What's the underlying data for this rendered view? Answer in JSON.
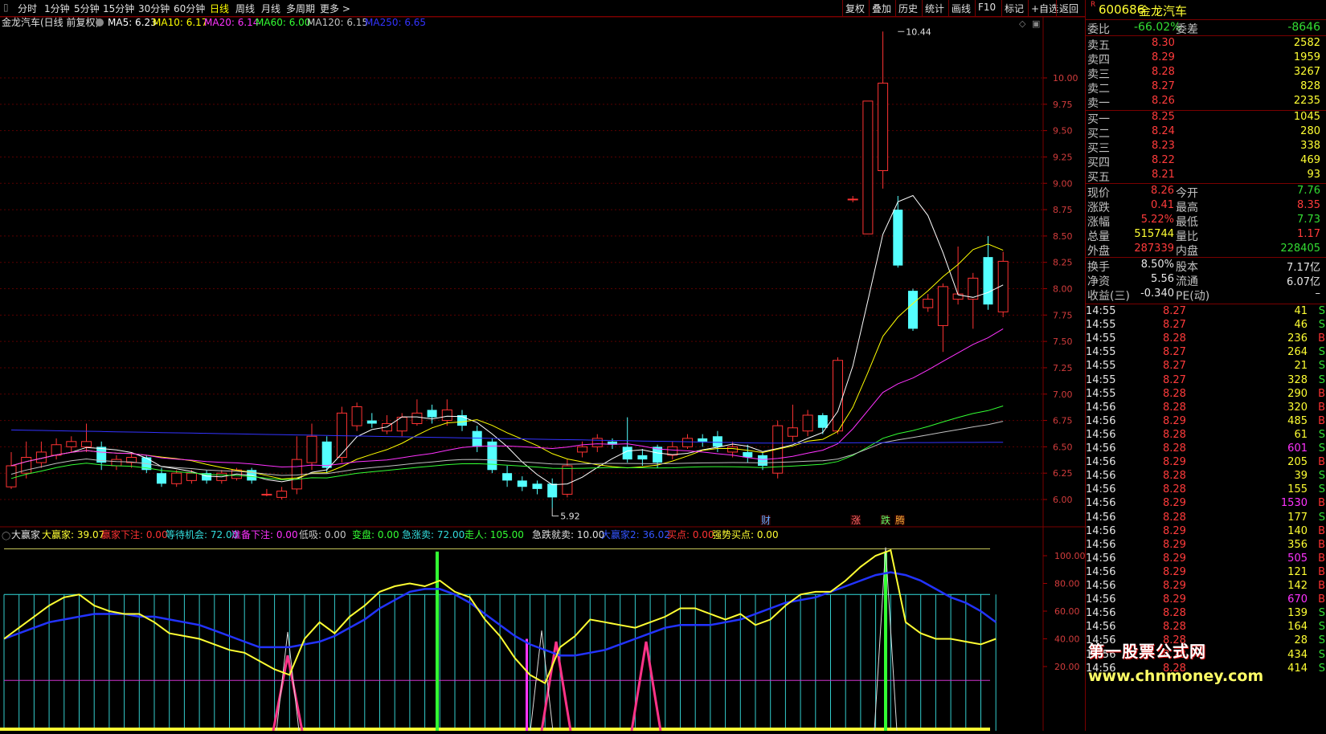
{
  "toolbar": {
    "periods": [
      "分时",
      "1分钟",
      "5分钟",
      "15分钟",
      "30分钟",
      "60分钟",
      "日线",
      "周线",
      "月线",
      "多周期",
      "更多 >"
    ],
    "active_period": "日线",
    "right_buttons": [
      "复权",
      "叠加",
      "历史",
      "统计",
      "画线",
      "F10",
      "标记",
      "+自选",
      "返回"
    ]
  },
  "main_chart": {
    "title": "金龙汽车(日线 前复权)",
    "ma_labels": [
      {
        "text": "MA5: 6.23",
        "color": "#ffffff"
      },
      {
        "text": "MA10: 6.17",
        "color": "#ffff00"
      },
      {
        "text": "MA20: 6.14",
        "color": "#ff33ff"
      },
      {
        "text": "MA60: 6.00",
        "color": "#33ff33"
      },
      {
        "text": "MA120: 6.15",
        "color": "#c0c0c0"
      },
      {
        "text": "MA250: 6.65",
        "color": "#3333ff"
      }
    ],
    "price_ticks": [
      "10.00",
      "9.75",
      "9.50",
      "9.25",
      "9.00",
      "8.75",
      "8.50",
      "8.25",
      "8.00",
      "7.75",
      "7.50",
      "7.25",
      "7.00",
      "6.75",
      "6.50",
      "6.25",
      "6.00"
    ],
    "high_label": "10.44",
    "low_label": "5.92",
    "markers": [
      {
        "text": "财",
        "color": "#66aaff"
      },
      {
        "text": "涨",
        "color": "#ff6666"
      },
      {
        "text": "跌",
        "color": "#66ff66"
      },
      {
        "text": "腾",
        "color": "#ffaa33"
      }
    ]
  },
  "chart_data": {
    "type": "candlestick",
    "ylim": [
      5.9,
      10.6
    ],
    "candles": [
      {
        "o": 6.12,
        "c": 6.32,
        "h": 6.45,
        "l": 6.1
      },
      {
        "o": 6.25,
        "c": 6.4,
        "h": 6.55,
        "l": 6.2
      },
      {
        "o": 6.35,
        "c": 6.45,
        "h": 6.55,
        "l": 6.3
      },
      {
        "o": 6.42,
        "c": 6.52,
        "h": 6.58,
        "l": 6.38
      },
      {
        "o": 6.5,
        "c": 6.55,
        "h": 6.6,
        "l": 6.45
      },
      {
        "o": 6.5,
        "c": 6.55,
        "h": 6.72,
        "l": 6.45
      },
      {
        "o": 6.5,
        "c": 6.35,
        "h": 6.55,
        "l": 6.28
      },
      {
        "o": 6.32,
        "c": 6.38,
        "h": 6.42,
        "l": 6.28
      },
      {
        "o": 6.35,
        "c": 6.4,
        "h": 6.45,
        "l": 6.3
      },
      {
        "o": 6.4,
        "c": 6.28,
        "h": 6.42,
        "l": 6.25
      },
      {
        "o": 6.25,
        "c": 6.15,
        "h": 6.3,
        "l": 6.12
      },
      {
        "o": 6.15,
        "c": 6.25,
        "h": 6.28,
        "l": 6.12
      },
      {
        "o": 6.18,
        "c": 6.25,
        "h": 6.28,
        "l": 6.15
      },
      {
        "o": 6.25,
        "c": 6.18,
        "h": 6.28,
        "l": 6.15
      },
      {
        "o": 6.18,
        "c": 6.25,
        "h": 6.28,
        "l": 6.15
      },
      {
        "o": 6.2,
        "c": 6.28,
        "h": 6.3,
        "l": 6.18
      },
      {
        "o": 6.28,
        "c": 6.18,
        "h": 6.3,
        "l": 6.15
      },
      {
        "o": 6.05,
        "c": 6.05,
        "h": 6.1,
        "l": 6.03
      },
      {
        "o": 6.02,
        "c": 6.08,
        "h": 6.12,
        "l": 6.0
      },
      {
        "o": 6.1,
        "c": 6.38,
        "h": 6.6,
        "l": 6.05
      },
      {
        "o": 6.35,
        "c": 6.6,
        "h": 6.72,
        "l": 6.28
      },
      {
        "o": 6.55,
        "c": 6.3,
        "h": 6.6,
        "l": 6.25
      },
      {
        "o": 6.4,
        "c": 6.82,
        "h": 6.88,
        "l": 6.35
      },
      {
        "o": 6.7,
        "c": 6.88,
        "h": 6.92,
        "l": 6.65
      },
      {
        "o": 6.75,
        "c": 6.72,
        "h": 6.82,
        "l": 6.68
      },
      {
        "o": 6.65,
        "c": 6.72,
        "h": 6.8,
        "l": 6.62
      },
      {
        "o": 6.65,
        "c": 6.78,
        "h": 6.82,
        "l": 6.6
      },
      {
        "o": 6.72,
        "c": 6.82,
        "h": 6.95,
        "l": 6.7
      },
      {
        "o": 6.85,
        "c": 6.78,
        "h": 6.9,
        "l": 6.72
      },
      {
        "o": 6.75,
        "c": 6.85,
        "h": 6.95,
        "l": 6.7
      },
      {
        "o": 6.8,
        "c": 6.7,
        "h": 6.85,
        "l": 6.65
      },
      {
        "o": 6.65,
        "c": 6.5,
        "h": 6.7,
        "l": 6.45
      },
      {
        "o": 6.55,
        "c": 6.28,
        "h": 6.58,
        "l": 6.25
      },
      {
        "o": 6.25,
        "c": 6.18,
        "h": 6.32,
        "l": 6.12
      },
      {
        "o": 6.18,
        "c": 6.12,
        "h": 6.22,
        "l": 6.08
      },
      {
        "o": 6.15,
        "c": 6.1,
        "h": 6.18,
        "l": 6.05
      },
      {
        "o": 6.15,
        "c": 6.02,
        "h": 6.2,
        "l": 5.92
      },
      {
        "o": 6.05,
        "c": 6.32,
        "h": 6.38,
        "l": 6.02
      },
      {
        "o": 6.45,
        "c": 6.5,
        "h": 6.55,
        "l": 6.4
      },
      {
        "o": 6.5,
        "c": 6.58,
        "h": 6.62,
        "l": 6.45
      },
      {
        "o": 6.55,
        "c": 6.52,
        "h": 6.58,
        "l": 6.48
      },
      {
        "o": 6.5,
        "c": 6.38,
        "h": 6.78,
        "l": 6.35
      },
      {
        "o": 6.42,
        "c": 6.38,
        "h": 6.48,
        "l": 6.32
      },
      {
        "o": 6.5,
        "c": 6.35,
        "h": 6.52,
        "l": 6.3
      },
      {
        "o": 6.42,
        "c": 6.5,
        "h": 6.55,
        "l": 6.38
      },
      {
        "o": 6.5,
        "c": 6.58,
        "h": 6.62,
        "l": 6.48
      },
      {
        "o": 6.58,
        "c": 6.55,
        "h": 6.62,
        "l": 6.5
      },
      {
        "o": 6.6,
        "c": 6.5,
        "h": 6.65,
        "l": 6.45
      },
      {
        "o": 6.45,
        "c": 6.5,
        "h": 6.55,
        "l": 6.4
      },
      {
        "o": 6.45,
        "c": 6.4,
        "h": 6.52,
        "l": 6.35
      },
      {
        "o": 6.42,
        "c": 6.32,
        "h": 6.45,
        "l": 6.28
      },
      {
        "o": 6.25,
        "c": 6.7,
        "h": 6.75,
        "l": 6.2
      },
      {
        "o": 6.6,
        "c": 6.68,
        "h": 6.9,
        "l": 6.55
      },
      {
        "o": 6.65,
        "c": 6.8,
        "h": 6.85,
        "l": 6.6
      },
      {
        "o": 6.8,
        "c": 6.68,
        "h": 6.82,
        "l": 6.62
      },
      {
        "o": 6.65,
        "c": 7.32,
        "h": 7.35,
        "l": 6.62
      },
      {
        "o": 8.85,
        "c": 8.85,
        "h": 8.88,
        "l": 8.82
      },
      {
        "o": 8.52,
        "c": 9.78,
        "h": 9.78,
        "l": 8.52
      },
      {
        "o": 9.12,
        "c": 9.95,
        "h": 10.44,
        "l": 8.95
      },
      {
        "o": 8.75,
        "c": 8.22,
        "h": 8.88,
        "l": 8.2
      },
      {
        "o": 7.98,
        "c": 7.62,
        "h": 8.0,
        "l": 7.6
      },
      {
        "o": 7.82,
        "c": 7.9,
        "h": 7.95,
        "l": 7.78
      },
      {
        "o": 7.65,
        "c": 8.02,
        "h": 8.05,
        "l": 7.4
      },
      {
        "o": 7.9,
        "c": 7.95,
        "h": 8.4,
        "l": 7.85
      },
      {
        "o": 7.9,
        "c": 8.1,
        "h": 8.15,
        "l": 7.62
      },
      {
        "o": 8.3,
        "c": 7.85,
        "h": 8.5,
        "l": 7.8
      },
      {
        "o": 7.78,
        "c": 8.26,
        "h": 8.35,
        "l": 7.73
      }
    ]
  },
  "indicator": {
    "name": "大赢家",
    "labels": [
      {
        "text": "大赢家: 39.07",
        "color": "#ffff33"
      },
      {
        "text": "赢家下注: 0.00",
        "color": "#ff3333"
      },
      {
        "text": "等待机会: 72.00",
        "color": "#33dddd"
      },
      {
        "text": "准备下注: 0.00",
        "color": "#ff33ff"
      },
      {
        "text": "低吸: 0.00",
        "color": "#c8c8c8"
      },
      {
        "text": "变盘: 0.00",
        "color": "#33ff33"
      },
      {
        "text": "急涨卖: 72.00",
        "color": "#33dddd"
      },
      {
        "text": "走人: 105.00",
        "color": "#33ff33"
      },
      {
        "text": "急跌就卖: 10.00",
        "color": "#e0e0e0"
      },
      {
        "text": "大赢家2: 36.02",
        "color": "#3355ff"
      },
      {
        "text": "买点: 0.00",
        "color": "#ff3333"
      },
      {
        "text": "强势买点: 0.00",
        "color": "#ffff33"
      }
    ],
    "ticks": [
      "100.00",
      "80.00",
      "60.00",
      "40.00",
      "20.00"
    ],
    "yellow_line": [
      40,
      48,
      56,
      64,
      70,
      72,
      64,
      60,
      58,
      58,
      52,
      44,
      42,
      40,
      36,
      32,
      30,
      24,
      18,
      14,
      40,
      52,
      44,
      56,
      64,
      74,
      78,
      80,
      78,
      82,
      74,
      70,
      54,
      42,
      26,
      14,
      8,
      34,
      42,
      54,
      52,
      50,
      48,
      52,
      56,
      62,
      62,
      58,
      54,
      58,
      50,
      54,
      64,
      72,
      74,
      74,
      82,
      92,
      100,
      104,
      52,
      44,
      40,
      40,
      38,
      36,
      40
    ],
    "blue_line": [
      40,
      44,
      48,
      52,
      54,
      56,
      58,
      58,
      58,
      56,
      56,
      54,
      52,
      50,
      46,
      42,
      38,
      34,
      34,
      34,
      36,
      38,
      42,
      48,
      54,
      62,
      68,
      74,
      76,
      76,
      72,
      66,
      58,
      50,
      42,
      36,
      32,
      28,
      28,
      30,
      32,
      36,
      40,
      44,
      48,
      50,
      50,
      50,
      52,
      54,
      58,
      62,
      66,
      68,
      70,
      74,
      78,
      82,
      86,
      88,
      86,
      82,
      76,
      70,
      66,
      60,
      52
    ]
  },
  "quote": {
    "code": "600686",
    "name": "金龙汽车",
    "r_tag": "R",
    "webi_label": "委比",
    "webi_value": "-66.02%",
    "weicha_label": "委差",
    "weicha_value": "-8646",
    "sell": [
      {
        "label": "卖五",
        "price": "8.30",
        "vol": "2582"
      },
      {
        "label": "卖四",
        "price": "8.29",
        "vol": "1959"
      },
      {
        "label": "卖三",
        "price": "8.28",
        "vol": "3267"
      },
      {
        "label": "卖二",
        "price": "8.27",
        "vol": "828"
      },
      {
        "label": "卖一",
        "price": "8.26",
        "vol": "2235"
      }
    ],
    "buy": [
      {
        "label": "买一",
        "price": "8.25",
        "vol": "1045"
      },
      {
        "label": "买二",
        "price": "8.24",
        "vol": "280"
      },
      {
        "label": "买三",
        "price": "8.23",
        "vol": "338"
      },
      {
        "label": "买四",
        "price": "8.22",
        "vol": "469"
      },
      {
        "label": "买五",
        "price": "8.21",
        "vol": "93"
      }
    ],
    "stats": [
      {
        "l1": "现价",
        "v1": "8.26",
        "c1": "#ff3b3b",
        "l2": "今开",
        "v2": "7.76",
        "c2": "#33dd33"
      },
      {
        "l1": "涨跌",
        "v1": "0.41",
        "c1": "#ff3b3b",
        "l2": "最高",
        "v2": "8.35",
        "c2": "#ff3b3b"
      },
      {
        "l1": "涨幅",
        "v1": "5.22%",
        "c1": "#ff3b3b",
        "l2": "最低",
        "v2": "7.73",
        "c2": "#33dd33"
      },
      {
        "l1": "总量",
        "v1": "515744",
        "c1": "#ffff33",
        "l2": "量比",
        "v2": "1.17",
        "c2": "#ff3b3b"
      },
      {
        "l1": "外盘",
        "v1": "287339",
        "c1": "#ff3b3b",
        "l2": "内盘",
        "v2": "228405",
        "c2": "#33dd33"
      }
    ],
    "stats2": [
      {
        "l1": "换手",
        "v1": "8.50%",
        "l2": "股本",
        "v2": "7.17亿"
      },
      {
        "l1": "净资",
        "v1": "5.56",
        "l2": "流通",
        "v2": "6.07亿"
      },
      {
        "l1": "收益(三)",
        "v1": "-0.340",
        "l2": "PE(动)",
        "v2": "–"
      }
    ],
    "ticks": [
      {
        "t": "14:55",
        "p": "8.27",
        "v": "41",
        "s": "S"
      },
      {
        "t": "14:55",
        "p": "8.27",
        "v": "46",
        "s": "S"
      },
      {
        "t": "14:55",
        "p": "8.28",
        "v": "236",
        "s": "B"
      },
      {
        "t": "14:55",
        "p": "8.27",
        "v": "264",
        "s": "S"
      },
      {
        "t": "14:55",
        "p": "8.27",
        "v": "21",
        "s": "S"
      },
      {
        "t": "14:55",
        "p": "8.27",
        "v": "328",
        "s": "S"
      },
      {
        "t": "14:55",
        "p": "8.28",
        "v": "290",
        "s": "B"
      },
      {
        "t": "14:56",
        "p": "8.28",
        "v": "320",
        "s": "B"
      },
      {
        "t": "14:56",
        "p": "8.29",
        "v": "485",
        "s": "B"
      },
      {
        "t": "14:56",
        "p": "8.28",
        "v": "61",
        "s": "S"
      },
      {
        "t": "14:56",
        "p": "8.28",
        "v": "601",
        "s": "S"
      },
      {
        "t": "14:56",
        "p": "8.29",
        "v": "205",
        "s": "B"
      },
      {
        "t": "14:56",
        "p": "8.28",
        "v": "39",
        "s": "S"
      },
      {
        "t": "14:56",
        "p": "8.28",
        "v": "155",
        "s": "S"
      },
      {
        "t": "14:56",
        "p": "8.29",
        "v": "1530",
        "s": "B"
      },
      {
        "t": "14:56",
        "p": "8.28",
        "v": "177",
        "s": "S"
      },
      {
        "t": "14:56",
        "p": "8.29",
        "v": "140",
        "s": "B"
      },
      {
        "t": "14:56",
        "p": "8.29",
        "v": "356",
        "s": "B"
      },
      {
        "t": "14:56",
        "p": "8.29",
        "v": "505",
        "s": "B"
      },
      {
        "t": "14:56",
        "p": "8.29",
        "v": "121",
        "s": "B"
      },
      {
        "t": "14:56",
        "p": "8.29",
        "v": "142",
        "s": "B"
      },
      {
        "t": "14:56",
        "p": "8.29",
        "v": "670",
        "s": "B"
      },
      {
        "t": "14:56",
        "p": "8.28",
        "v": "139",
        "s": "S"
      },
      {
        "t": "14:56",
        "p": "8.28",
        "v": "164",
        "s": "S"
      },
      {
        "t": "14:56",
        "p": "8.28",
        "v": "28",
        "s": "S"
      },
      {
        "t": "14:56",
        "p": "8.28",
        "v": "434",
        "s": "S"
      },
      {
        "t": "14:56",
        "p": "8.28",
        "v": "414",
        "s": "S"
      }
    ]
  },
  "watermark": {
    "line1": "第一股票公式网",
    "line2": "www.chnmoney.com"
  }
}
